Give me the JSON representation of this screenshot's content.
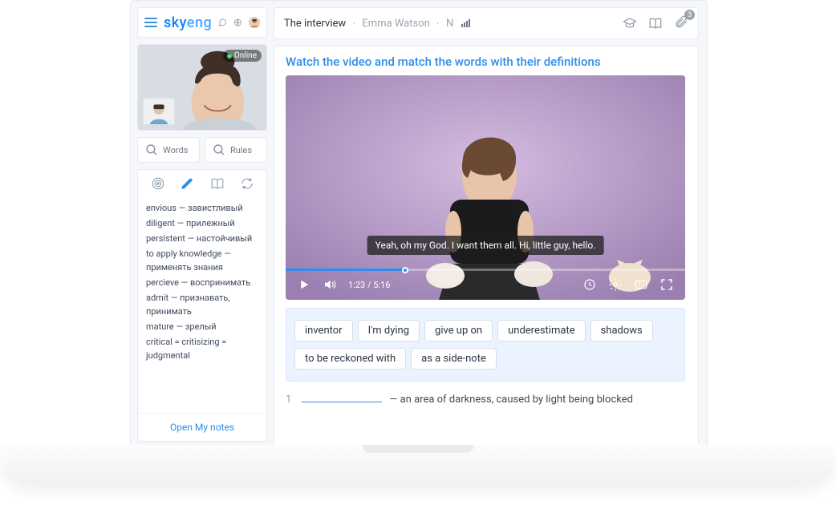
{
  "brand": {
    "part1": "sky",
    "part2": "eng"
  },
  "webcam": {
    "status": "Online"
  },
  "search": {
    "words": "Words",
    "rules": "Rules"
  },
  "sidebar": {
    "open_notes": "Open My notes",
    "vocabulary": [
      "envious — завистливый",
      "diligent — прилежный",
      "persistent — настойчивый",
      "to apply knowledge — применять знания",
      "percieve — воспринимать",
      "admit — признавать, принимать",
      "mature — зрелый",
      "critical = critisizing = judgmental"
    ]
  },
  "header": {
    "title": "The interview",
    "subtitle": "Emma Watson",
    "level": "N",
    "attachments_count": "3"
  },
  "task": {
    "instruction": "Watch the video and match the words with their definitions"
  },
  "video": {
    "subtitle": "Yeah, oh my God. I want them all. Hi, little guy, hello.",
    "current": "1:23",
    "total": "5:16"
  },
  "word_bank": [
    "inventor",
    "I'm dying",
    "give up on",
    "underestimate",
    "shadows",
    "to be reckoned with",
    "as a side-note"
  ],
  "exercise": {
    "items": [
      {
        "num": "1",
        "definition": "— an area of darkness, caused by light being blocked"
      }
    ]
  }
}
